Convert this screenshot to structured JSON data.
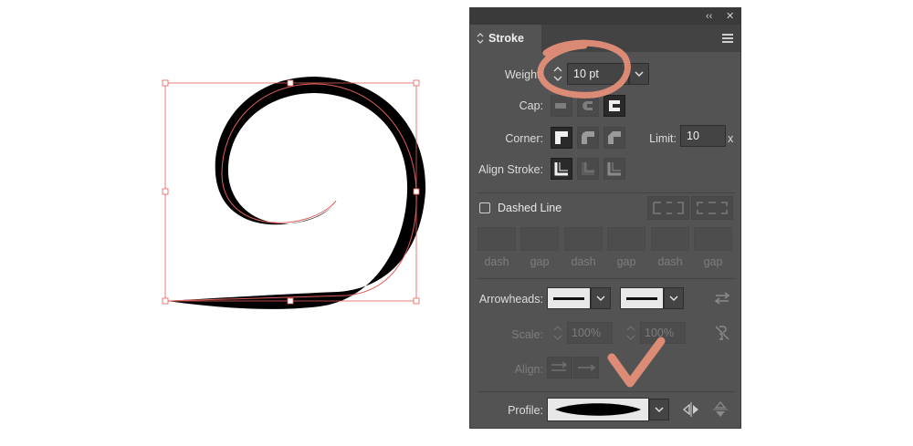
{
  "panel": {
    "title": "Stroke",
    "collapse_glyph": "‹‹",
    "close_glyph": "✕",
    "weight": {
      "label": "Weight:",
      "value": "10 pt"
    },
    "cap": {
      "label": "Cap:"
    },
    "corner": {
      "label": "Corner:",
      "limit_label": "Limit:",
      "limit_value": "10",
      "limit_unit": "x"
    },
    "align_stroke": {
      "label": "Align Stroke:"
    },
    "dashed_line": {
      "label": "Dashed Line",
      "checked": false
    },
    "dash_labels": [
      "dash",
      "gap",
      "dash",
      "gap",
      "dash",
      "gap"
    ],
    "arrowheads": {
      "label": "Arrowheads:"
    },
    "scale": {
      "label": "Scale:",
      "start": "100%",
      "end": "100%"
    },
    "align": {
      "label": "Align:"
    },
    "profile": {
      "label": "Profile:"
    }
  },
  "colors": {
    "panel_bg": "#535353",
    "path_selection": "#e0605a",
    "annotation_brush": "#e8917a",
    "stroke": "#000000"
  },
  "icons": [
    "chevron-left-double-icon",
    "close-icon",
    "panel-menu-icon",
    "stepper-icon",
    "dropdown-chevron-icon",
    "cap-butt-icon",
    "cap-round-icon",
    "cap-projecting-icon",
    "corner-miter-icon",
    "corner-round-icon",
    "corner-bevel-icon",
    "align-center-icon",
    "align-inside-icon",
    "align-outside-icon",
    "swap-arrowheads-icon",
    "link-scale-icon",
    "flip-profile-horizontal-icon",
    "flip-profile-vertical-icon"
  ]
}
